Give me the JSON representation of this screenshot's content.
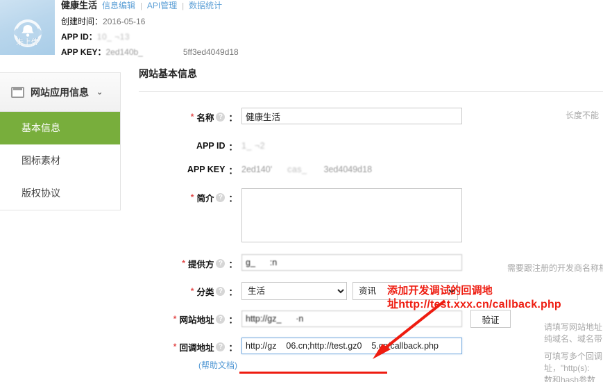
{
  "header": {
    "avatar_label": "未上传",
    "app_title": "健康生活",
    "tabs": [
      {
        "label": "信息编辑"
      },
      {
        "label": "API管理"
      },
      {
        "label": "数据统计"
      }
    ],
    "separator": "|",
    "created_label": "创建时间：",
    "created_value": "2016-05-16",
    "app_id_label": "APP ID：",
    "app_id_value": "10_      ¬13",
    "app_key_label": "APP KEY：",
    "app_key_value_a": "2ed140b_",
    "app_key_value_b": "5ff3ed4049d18"
  },
  "sidebar": {
    "header_label": "网站应用信息",
    "header_icon": "window-icon",
    "chevron": "⌄",
    "items": [
      {
        "label": "基本信息",
        "active": true
      },
      {
        "label": "图标素材",
        "active": false
      },
      {
        "label": "版权协议",
        "active": false
      }
    ]
  },
  "main": {
    "panel_title": "网站基本信息",
    "fields": {
      "name": {
        "label": "名称",
        "required": "*",
        "colon": "：",
        "value": "健康生活",
        "hint": "长度不能"
      },
      "app_id": {
        "label": "APP ID",
        "colon": "：",
        "value": "1_      ¬2"
      },
      "app_key": {
        "label": "APP KEY",
        "colon": "：",
        "value_a": "2ed140'",
        "value_b": "cas_",
        "value_c": "3ed4049d18"
      },
      "intro": {
        "label": "简介",
        "required": "*",
        "colon": "：",
        "value": ""
      },
      "provider": {
        "label": "提供方",
        "required": "*",
        "colon": "：",
        "value": "g_      :n",
        "hint": "需要跟注册的开发商名称相"
      },
      "category": {
        "label": "分类",
        "required": "*",
        "colon": "：",
        "value_primary": "生活",
        "value_secondary": "资讯",
        "options_primary": [
          "生活"
        ],
        "options_secondary": [
          "资讯"
        ]
      },
      "site_url": {
        "label": "网站地址",
        "required": "*",
        "colon": "：",
        "value": "http://gz_      ·n",
        "verify_button": "验证",
        "hint_line1": "请填写网站地址",
        "hint_line2": "纯域名、域名带"
      },
      "callback_url": {
        "label": "回调地址",
        "required": "*",
        "colon": "：",
        "help_link": "(帮助文档)",
        "value": "http://gz    06.cn;http://test.gz0    5.cn/callback.php",
        "hint_line1": "可填写多个回调",
        "hint_line2": "址，\"http(s):",
        "hint_line3": "数和hash参数"
      }
    }
  },
  "annotation": {
    "line1": "添加开发调试的回调地",
    "line2": "址http://test.xxx.cn/callback.php",
    "color": "#ee1c10"
  },
  "colors": {
    "sidebar_active": "#78ae3c",
    "link": "#5c9fd6",
    "annotation_red": "#ee1c10",
    "focus_border": "#7aaee0"
  }
}
